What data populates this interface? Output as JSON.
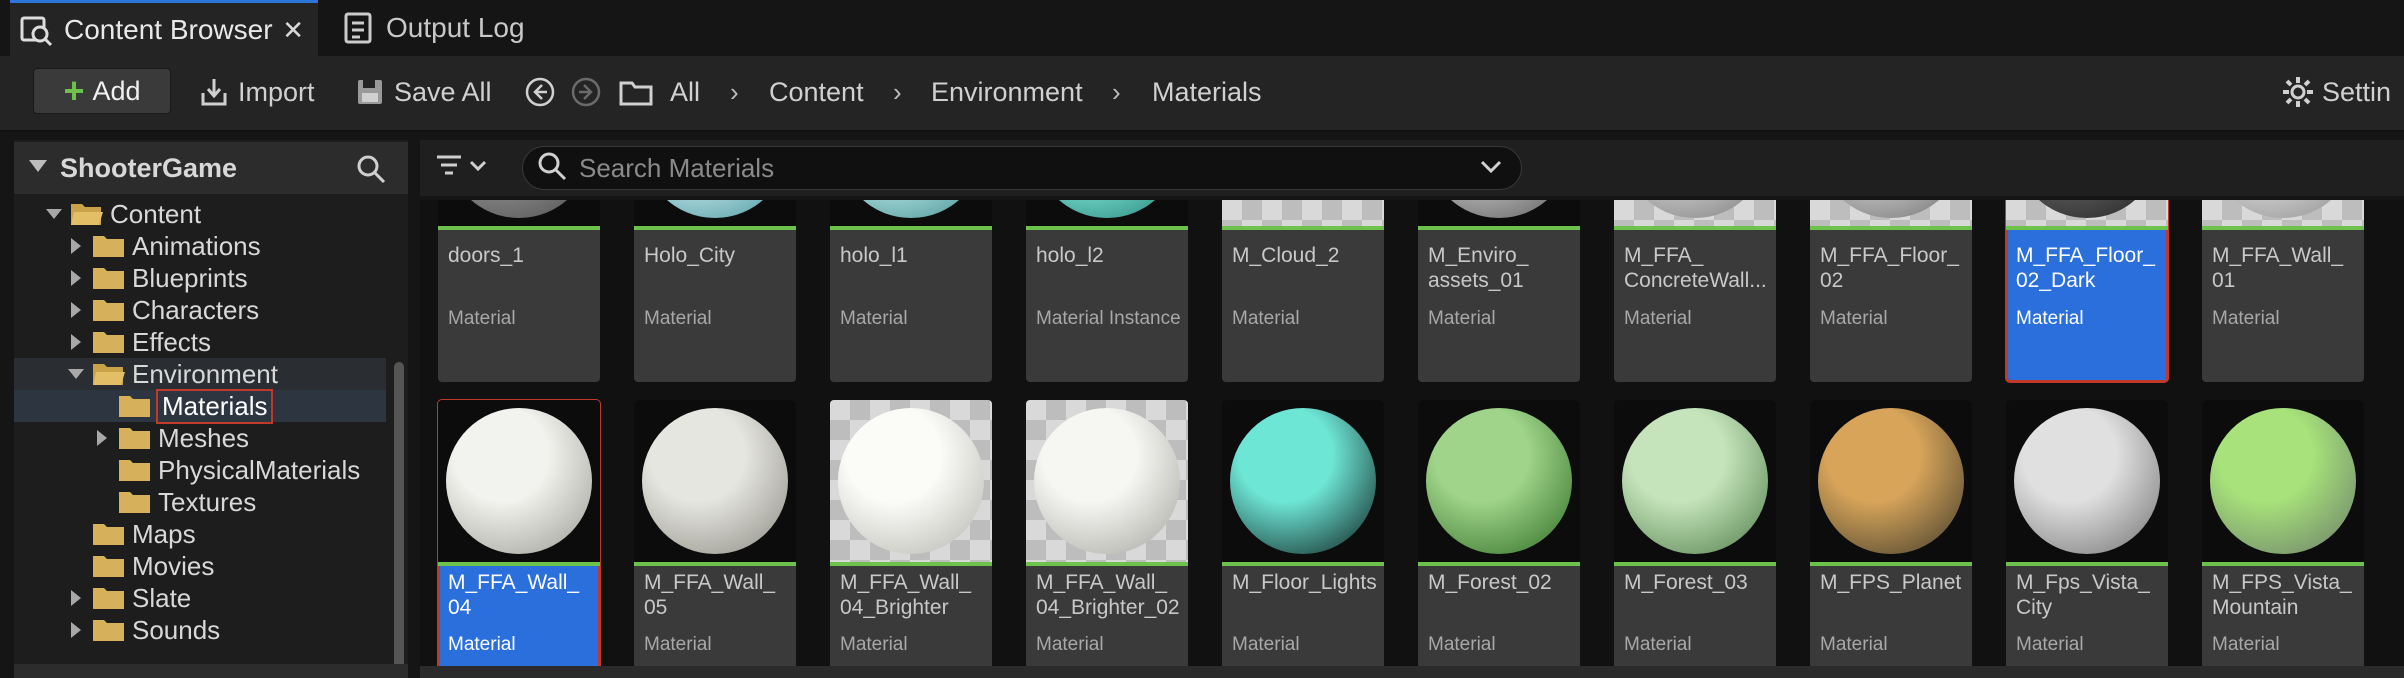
{
  "tabs": [
    {
      "label": "Content Browser",
      "active": true,
      "icon": "content-browser-icon"
    },
    {
      "label": "Output Log",
      "active": false,
      "icon": "output-log-icon"
    }
  ],
  "toolbar": {
    "add_label": "Add",
    "import_label": "Import",
    "save_all_label": "Save All",
    "settings_label": "Settin"
  },
  "breadcrumb": [
    "All",
    "Content",
    "Environment",
    "Materials"
  ],
  "left_panel": {
    "title": "ShooterGame",
    "tree": [
      {
        "label": "Content",
        "expanded": true,
        "depth": 0
      },
      {
        "label": "Animations",
        "expanded": false,
        "depth": 1
      },
      {
        "label": "Blueprints",
        "expanded": false,
        "depth": 1
      },
      {
        "label": "Characters",
        "expanded": false,
        "depth": 1
      },
      {
        "label": "Effects",
        "expanded": false,
        "depth": 1
      },
      {
        "label": "Environment",
        "expanded": true,
        "depth": 1
      },
      {
        "label": "Materials",
        "depth": 2,
        "selected": true
      },
      {
        "label": "Meshes",
        "expanded": false,
        "depth": 2
      },
      {
        "label": "PhysicalMaterials",
        "depth": 2
      },
      {
        "label": "Textures",
        "depth": 2
      },
      {
        "label": "Maps",
        "depth": 1
      },
      {
        "label": "Movies",
        "depth": 1
      },
      {
        "label": "Slate",
        "expanded": false,
        "depth": 1
      },
      {
        "label": "Sounds",
        "expanded": false,
        "depth": 1
      }
    ]
  },
  "search": {
    "placeholder": "Search Materials",
    "value": ""
  },
  "assets_row1": [
    {
      "name": "doors_1",
      "type": "Material"
    },
    {
      "name": "Holo_City",
      "type": "Material"
    },
    {
      "name": "holo_l1",
      "type": "Material"
    },
    {
      "name": "holo_l2",
      "type": "Material Instance"
    },
    {
      "name": "M_Cloud_2",
      "type": "Material"
    },
    {
      "name": "M_Enviro_\nassets_01",
      "type": "Material"
    },
    {
      "name": "M_FFA_\nConcreteWall...",
      "type": "Material"
    },
    {
      "name": "M_FFA_Floor_\n02",
      "type": "Material"
    },
    {
      "name": "M_FFA_Floor_\n02_Dark",
      "type": "Material",
      "selected": true
    },
    {
      "name": "M_FFA_Wall_\n01",
      "type": "Material"
    }
  ],
  "assets_row2": [
    {
      "name": "M_FFA_Wall_\n04",
      "type": "Material",
      "selected": true
    },
    {
      "name": "M_FFA_Wall_\n05",
      "type": "Material"
    },
    {
      "name": "M_FFA_Wall_\n04_Brighter",
      "type": "Material"
    },
    {
      "name": "M_FFA_Wall_\n04_Brighter_02",
      "type": "Material"
    },
    {
      "name": "M_Floor_Lights",
      "type": "Material"
    },
    {
      "name": "M_Forest_02",
      "type": "Material"
    },
    {
      "name": "M_Forest_03",
      "type": "Material"
    },
    {
      "name": "M_FPS_Planet",
      "type": "Material"
    },
    {
      "name": "M_Fps_Vista_\nCity",
      "type": "Material"
    },
    {
      "name": "M_FPS_Vista_\nMountain",
      "type": "Material"
    }
  ],
  "colors": {
    "accent": "#2a77d9",
    "asset_bar": "#6cc24a",
    "selection": "#2a6fdb",
    "highlight_outline": "#c0392b"
  }
}
